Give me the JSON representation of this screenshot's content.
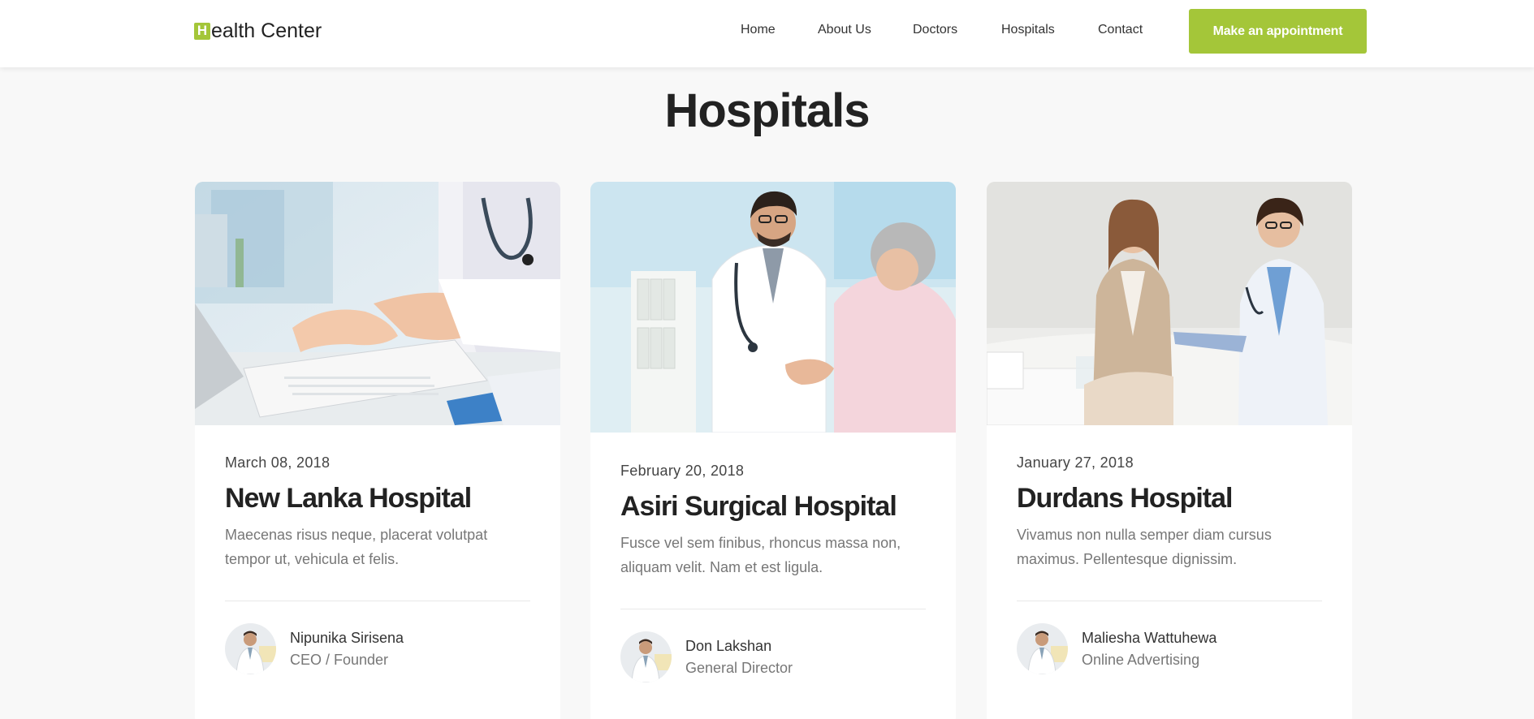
{
  "brand": {
    "mark": "H",
    "name": "ealth Center"
  },
  "nav": {
    "items": [
      "Home",
      "About Us",
      "Doctors",
      "Hospitals",
      "Contact"
    ],
    "cta": "Make an appointment"
  },
  "page": {
    "title": "Hospitals"
  },
  "colors": {
    "accent": "#a4c639",
    "background": "#f8f8f8"
  },
  "cards": [
    {
      "image": "doctor-typing-on-laptop-photo",
      "date": "March 08, 2018",
      "title": "New Lanka Hospital",
      "description": "Maecenas risus neque, placerat volutpat tempor ut, vehicula et felis.",
      "author": {
        "name": "Nipunika Sirisena",
        "role": "CEO / Founder"
      }
    },
    {
      "image": "doctor-greeting-elderly-patient-photo",
      "date": "February 20, 2018",
      "title": "Asiri Surgical Hospital",
      "description": "Fusce vel sem finibus, rhoncus massa non, aliquam velit. Nam et est ligula.",
      "author": {
        "name": "Don Lakshan",
        "role": "General Director"
      }
    },
    {
      "image": "doctor-with-patient-on-sofa-photo",
      "date": "January 27, 2018",
      "title": "Durdans Hospital",
      "description": "Vivamus non nulla semper diam cursus maximus. Pellentesque dignissim.",
      "author": {
        "name": "Maliesha Wattuhewa",
        "role": "Online Advertising"
      }
    }
  ]
}
